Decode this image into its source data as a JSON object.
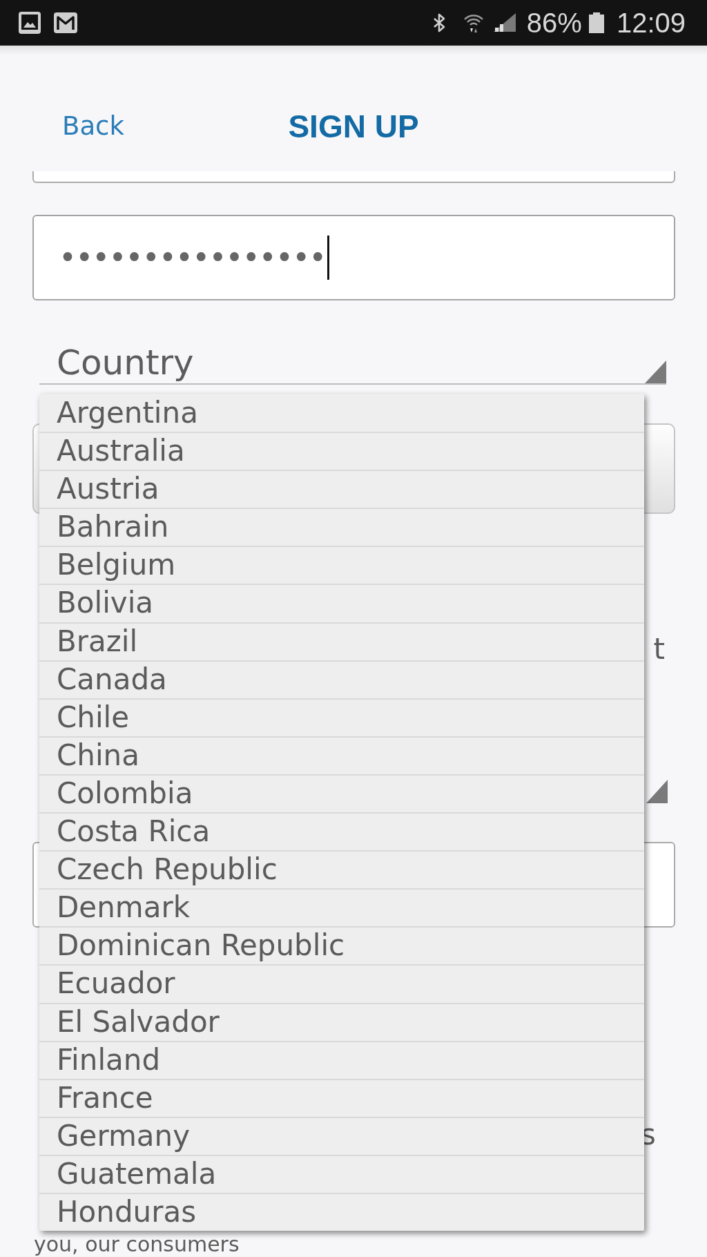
{
  "status_bar": {
    "battery": "86%",
    "time": "12:09"
  },
  "header": {
    "back_link": "Back",
    "title": "SIGN UP"
  },
  "form": {
    "password_field": {
      "value": "••••••••••••••••",
      "focused": true
    },
    "country_select": {
      "placeholder": "Country",
      "expanded": true,
      "options": [
        {
          "label": "Argentina",
          "selected": false
        },
        {
          "label": "Australia",
          "selected": false
        },
        {
          "label": "Austria",
          "selected": false
        },
        {
          "label": "Bahrain",
          "selected": false
        },
        {
          "label": "Belgium",
          "selected": false
        },
        {
          "label": "Bolivia",
          "selected": false
        },
        {
          "label": "Brazil",
          "selected": false
        },
        {
          "label": "Canada",
          "selected": false
        },
        {
          "label": "Chile",
          "selected": false
        },
        {
          "label": "China",
          "selected": false
        },
        {
          "label": "Colombia",
          "selected": false
        },
        {
          "label": "Costa Rica",
          "selected": false
        },
        {
          "label": "Czech Republic",
          "selected": false
        },
        {
          "label": "Denmark",
          "selected": false
        },
        {
          "label": "Dominican Republic",
          "selected": false
        },
        {
          "label": "Ecuador",
          "selected": false
        },
        {
          "label": "El Salvador",
          "selected": false
        },
        {
          "label": "Finland",
          "selected": false
        },
        {
          "label": "France",
          "selected": false
        },
        {
          "label": "Germany",
          "selected": false
        },
        {
          "label": "Guatemala",
          "selected": false
        },
        {
          "label": "Honduras",
          "selected": false
        }
      ]
    }
  },
  "behind_list": {
    "paragraph_1_tail": "t",
    "paragraph_2_tail": "s",
    "paragraph_2_last_line": "you, our consumers"
  }
}
